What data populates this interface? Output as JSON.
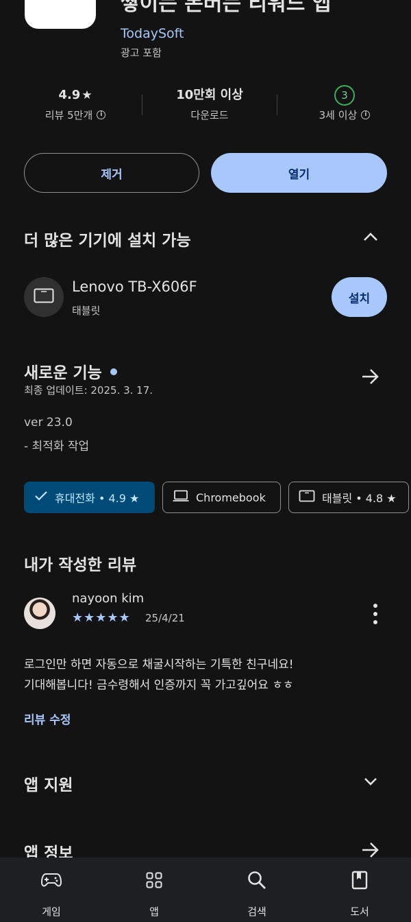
{
  "app": {
    "title": "쌓이는 돈버는 리워드 앱",
    "developer": "TodaySoft",
    "ads_notice": "광고 포함"
  },
  "stats": {
    "rating": "4.9",
    "rating_label": "리뷰 5만개",
    "downloads": "10만회 이상",
    "downloads_label": "다운로드",
    "age_badge": "3",
    "age_label": "3세 이상"
  },
  "actions": {
    "remove_label": "제거",
    "open_label": "열기"
  },
  "more_devices": {
    "title": "더 많은 기기에 설치 가능",
    "device_name": "Lenovo TB-X606F",
    "device_type": "태블릿",
    "install_label": "설치"
  },
  "whats_new": {
    "title": "새로운 기능",
    "updated": "최종 업데이트: 2025. 3. 17.",
    "version": "ver 23.0",
    "note": "- 최적화 작업"
  },
  "device_chips": [
    {
      "label": "휴대전화 • 4.9 ★",
      "selected": true
    },
    {
      "label": "Chromebook",
      "selected": false
    },
    {
      "label": "태블릿 • 4.8 ★",
      "selected": false
    }
  ],
  "my_review": {
    "title": "내가 작성한 리뷰",
    "reviewer": "nayoon kim",
    "stars": "★★★★★",
    "rating": 5,
    "date": "25/4/21",
    "text_line1": "로그인만 하면 자동으로 채굴시작하는 기특한 친구네요!",
    "text_line2": "기대해봅니다! 금수령해서 인증까지 꼭 가고깊어요 ㅎㅎ",
    "edit_label": "리뷰 수정"
  },
  "sections": {
    "app_support": "앱 지원",
    "app_info": "앱 정보"
  },
  "bottom_nav": {
    "games": "게임",
    "apps": "앱",
    "search": "검색",
    "books": "도서"
  },
  "colors": {
    "background": "#131314",
    "accent": "#a8c7fa",
    "chip_selected": "#004a77",
    "age_green": "#3eae5c"
  }
}
